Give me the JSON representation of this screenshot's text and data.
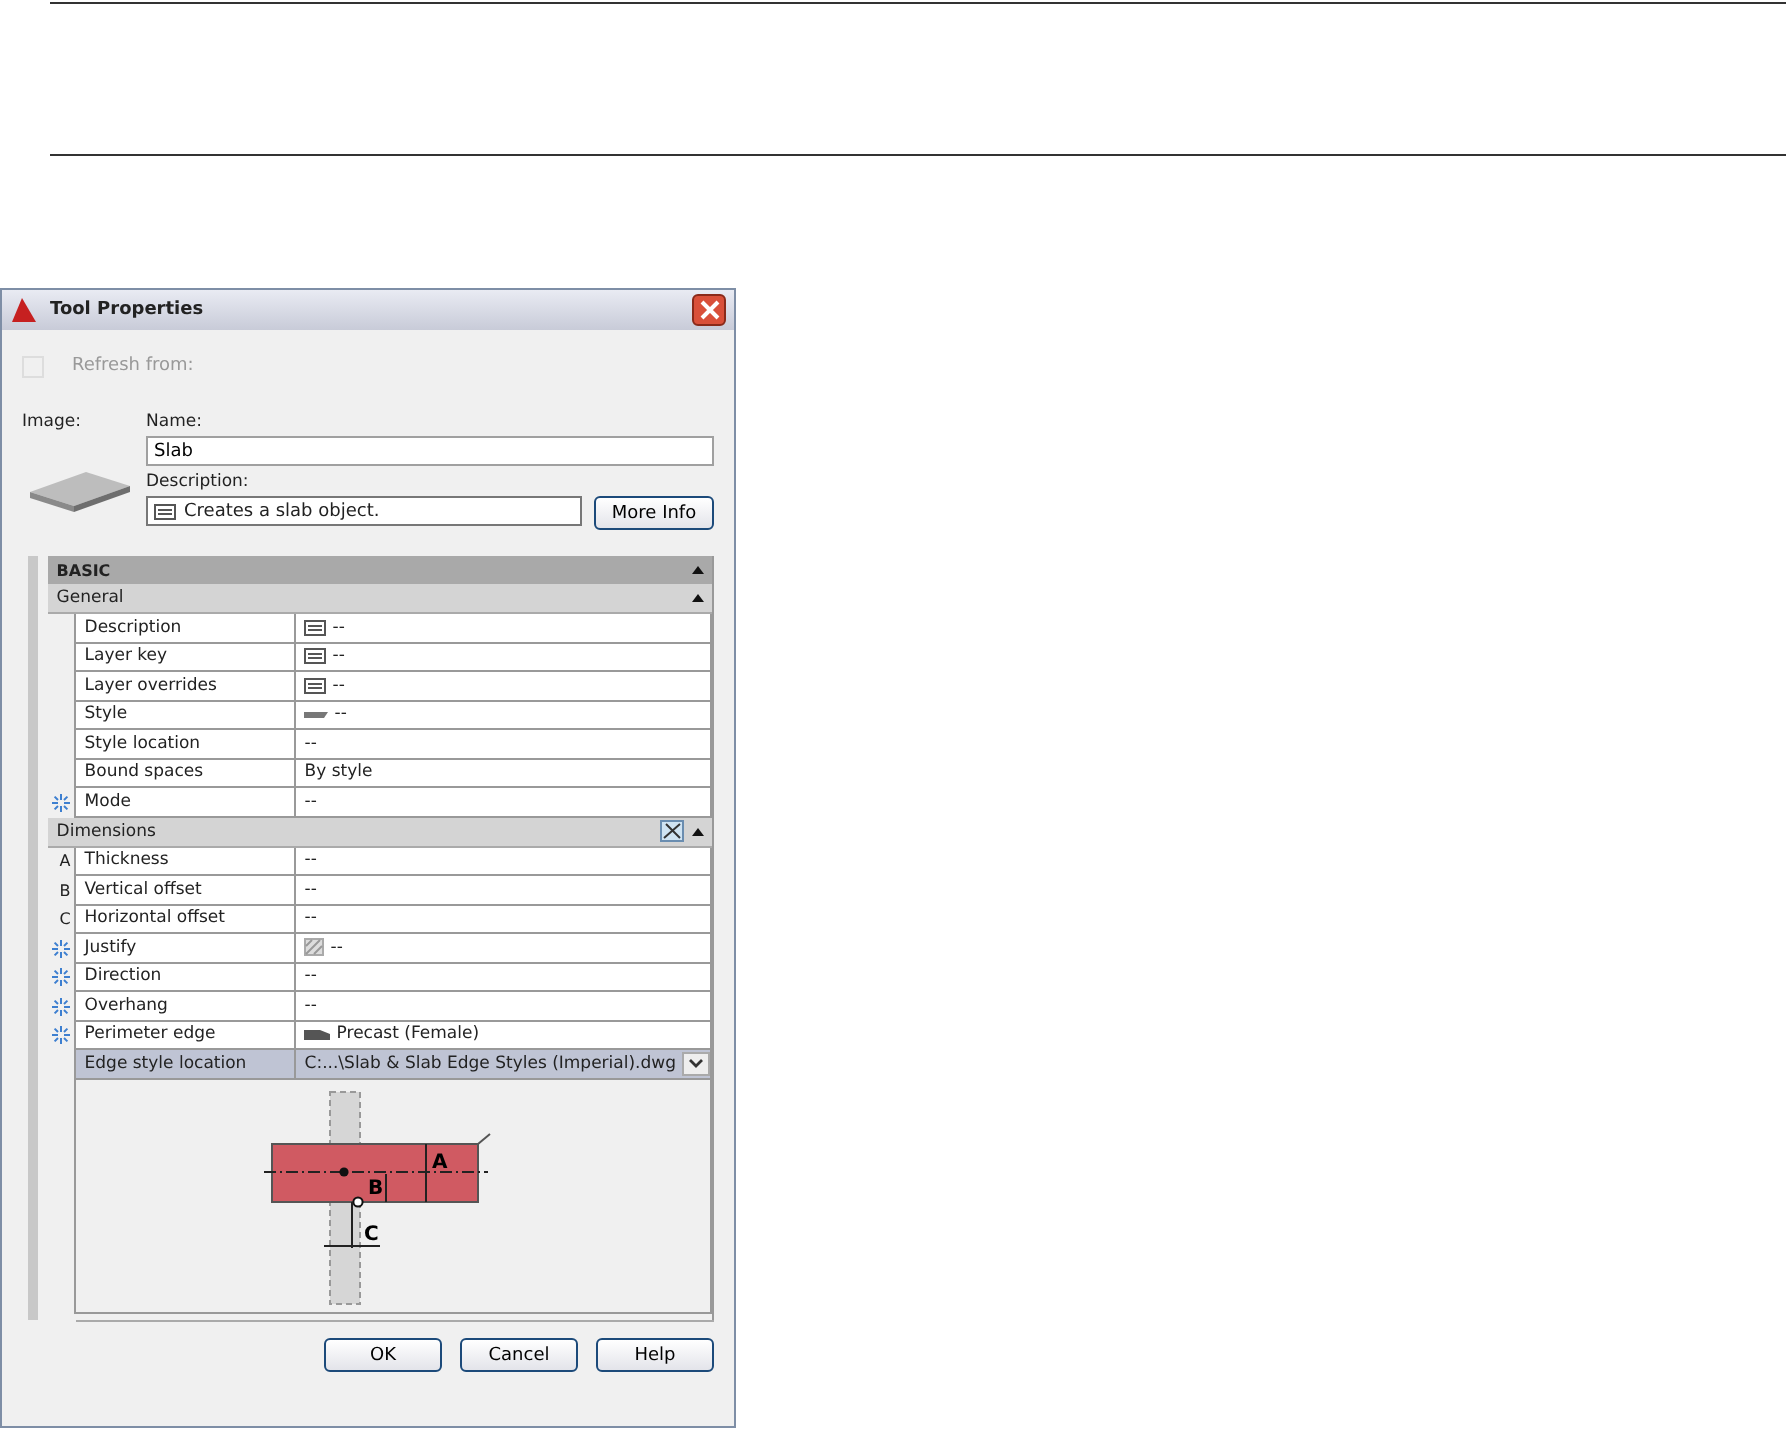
{
  "window": {
    "title": "Tool Properties"
  },
  "refresh": {
    "label": "Refresh from:",
    "checked": false,
    "disabled": true
  },
  "image_label": "Image:",
  "name": {
    "label": "Name:",
    "value": "Slab"
  },
  "description": {
    "label": "Description:",
    "value": "Creates a slab object."
  },
  "more_info": "More Info",
  "category": {
    "title": "BASIC",
    "expanded": true
  },
  "groups": [
    {
      "title": "General",
      "expanded": true,
      "tool_icon": false,
      "rows": [
        {
          "label": "Description",
          "value": "--",
          "kind": "plain",
          "selected": false,
          "dropdown": false
        },
        {
          "label": "Layer key",
          "value": "--",
          "kind": "plain",
          "selected": false,
          "dropdown": false
        },
        {
          "label": "Layer overrides",
          "value": "--",
          "kind": "plain",
          "selected": false,
          "dropdown": false
        },
        {
          "label": "Style",
          "value": "--",
          "kind": "plain",
          "selected": false,
          "dropdown": false
        },
        {
          "label": "Style location",
          "value": "--",
          "kind": "plain",
          "selected": false,
          "dropdown": false
        },
        {
          "label": "Bound spaces",
          "value": "By style",
          "kind": "plain",
          "selected": false,
          "dropdown": false
        },
        {
          "label": "Mode",
          "value": "--",
          "kind": "asterisk",
          "selected": false,
          "dropdown": false
        }
      ]
    },
    {
      "title": "Dimensions",
      "expanded": true,
      "tool_icon": true,
      "rows": [
        {
          "label": "Thickness",
          "value": "--",
          "kind": "letter",
          "letter": "A",
          "selected": false,
          "dropdown": false
        },
        {
          "label": "Vertical offset",
          "value": "--",
          "kind": "letter",
          "letter": "B",
          "selected": false,
          "dropdown": false
        },
        {
          "label": "Horizontal offset",
          "value": "--",
          "kind": "letter",
          "letter": "C",
          "selected": false,
          "dropdown": false
        },
        {
          "label": "Justify",
          "value": "--",
          "kind": "asterisk",
          "selected": false,
          "dropdown": false
        },
        {
          "label": "Direction",
          "value": "--",
          "kind": "asterisk",
          "selected": false,
          "dropdown": false
        },
        {
          "label": "Overhang",
          "value": "--",
          "kind": "asterisk",
          "selected": false,
          "dropdown": false
        },
        {
          "label": "Perimeter edge",
          "value": "Precast (Female)",
          "kind": "asterisk",
          "selected": false,
          "dropdown": false
        },
        {
          "label": "Edge style location",
          "value": "C:...\\Slab & Slab Edge Styles (Imperial).dwg",
          "kind": "plain",
          "selected": true,
          "dropdown": true
        }
      ]
    }
  ],
  "diagram_labels": [
    "A",
    "B",
    "C"
  ],
  "buttons": [
    "OK",
    "Cancel",
    "Help"
  ]
}
